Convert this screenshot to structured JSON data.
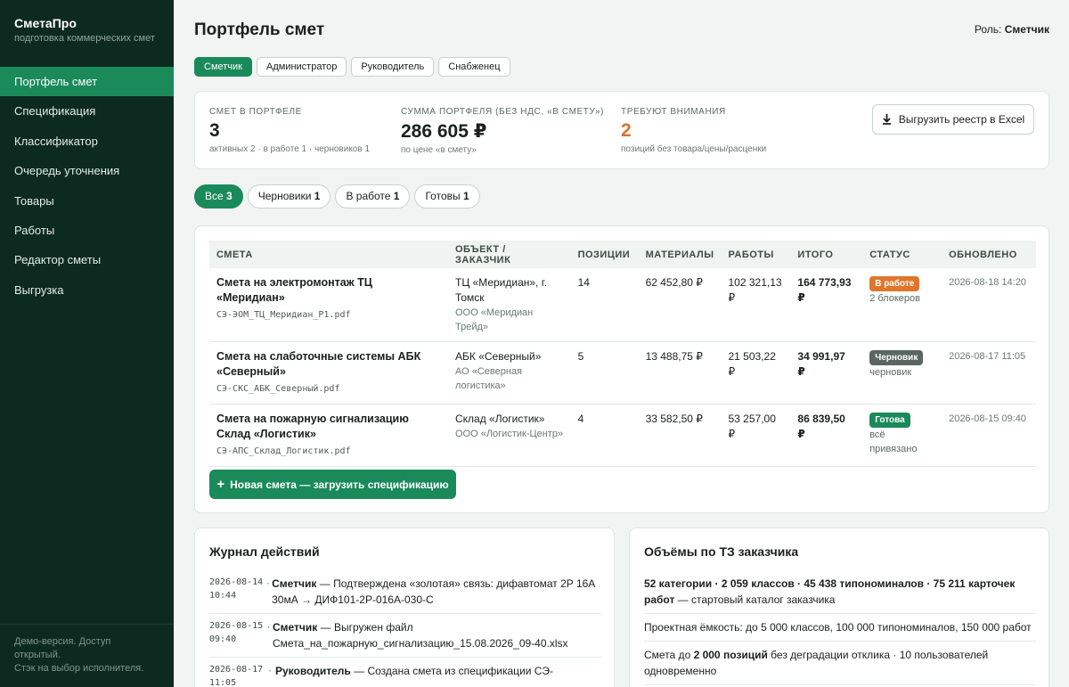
{
  "brand": {
    "name": "СметаПро",
    "subtitle": "подготовка коммерческих смет"
  },
  "nav": [
    "Портфель смет",
    "Спецификация",
    "Классификатор",
    "Очередь уточнения",
    "Товары",
    "Работы",
    "Редактор сметы",
    "Выгрузка"
  ],
  "nav_active": 0,
  "sidebar_footer": {
    "line1": "Демо-версия. Доступ открытый.",
    "line2": "Стэк на выбор исполнителя."
  },
  "page": {
    "title": "Портфель смет",
    "role_label": "Роль:",
    "role_value": "Сметчик"
  },
  "role_tabs": [
    "Сметчик",
    "Администратор",
    "Руководитель",
    "Снабженец"
  ],
  "stats": [
    {
      "label": "СМЕТ В ПОРТФЕЛЕ",
      "value": "3",
      "note": "активных 2 · в работе 1 · черновиков 1"
    },
    {
      "label": "СУММА ПОРТФЕЛЯ (БЕЗ НДС, «В СМЕТУ»)",
      "value": "286 605 ₽",
      "note": "по цене «в смету»"
    },
    {
      "label": "ТРЕБУЮТ ВНИМАНИЯ",
      "value": "2",
      "note": "позиций без товара/цены/расценки"
    }
  ],
  "export_button": "Выгрузить реестр в Excel",
  "filters": [
    {
      "label": "Все",
      "count": "3"
    },
    {
      "label": "Черновики",
      "count": "1"
    },
    {
      "label": "В работе",
      "count": "1"
    },
    {
      "label": "Готовы",
      "count": "1"
    }
  ],
  "table": {
    "headers": [
      "СМЕТА",
      "ОБЪЕКТ / ЗАКАЗЧИК",
      "ПОЗИЦИИ",
      "МАТЕРИАЛЫ",
      "РАБОТЫ",
      "ИТОГО",
      "СТАТУС",
      "ОБНОВЛЕНО"
    ],
    "rows": [
      {
        "name": "Смета на электромонтаж ТЦ «Меридиан»",
        "file": "СЭ-ЭОМ_ТЦ_Меридиан_Р1.pdf",
        "object": "ТЦ «Меридиан», г. Томск",
        "customer": "ООО «Меридиан Трейд»",
        "positions": "14",
        "materials": "62 452,80 ₽",
        "works": "102 321,13 ₽",
        "total": "164 773,93 ₽",
        "status": "В работе",
        "status_kind": "work",
        "status_note": "2 блокеров",
        "updated": "2026-08-18 14:20"
      },
      {
        "name": "Смета на слаботочные системы АБК «Северный»",
        "file": "СЭ-СКС_АБК_Северный.pdf",
        "object": "АБК «Северный»",
        "customer": "АО «Северная логистика»",
        "positions": "5",
        "materials": "13 488,75 ₽",
        "works": "21 503,22 ₽",
        "total": "34 991,97 ₽",
        "status": "Черновик",
        "status_kind": "draft",
        "status_note": "черновик",
        "updated": "2026-08-17 11:05"
      },
      {
        "name": "Смета на пожарную сигнализацию Склад «Логистик»",
        "file": "СЭ-АПС_Склад_Логистик.pdf",
        "object": "Склад «Логистик»",
        "customer": "ООО «Логистик-Центр»",
        "positions": "4",
        "materials": "33 582,50 ₽",
        "works": "53 257,00 ₽",
        "total": "86 839,50 ₽",
        "status": "Готова",
        "status_kind": "ready",
        "status_note": "всё привязано",
        "updated": "2026-08-15 09:40"
      }
    ]
  },
  "new_estimate_button": "Новая смета — загрузить спецификацию",
  "log": {
    "title": "Журнал действий",
    "entries": [
      {
        "ts": "2026-08-14 10:44",
        "actor": "Сметчик",
        "text": "— Подтверждена «золотая» связь: дифавтомат 2P 16A 30мА → ДИФ101-2Р-016А-030-С"
      },
      {
        "ts": "2026-08-15 09:40",
        "actor": "Сметчик",
        "text": "— Выгружен файл Смета_на_пожарную_сигнализацию_15.08.2026_09-40.xlsx"
      },
      {
        "ts": "2026-08-17 11:05",
        "actor": "Руководитель",
        "text": "— Создана смета из спецификации СЭ-"
      }
    ]
  },
  "volumes": {
    "title": "Объёмы по ТЗ заказчика",
    "rows": [
      {
        "bold": "52 категории · 2 059 классов · 45 438 типономиналов · 75 211 карточек работ",
        "text": " — стартовый каталог заказчика"
      },
      {
        "bold": "",
        "text": "Проектная ёмкость: до 5 000 классов, 100 000 типономиналов, 150 000 работ"
      },
      {
        "pre": "Смета до ",
        "bold": "2 000 позиций",
        "text": " без деградации отклика · 10 пользователей одновременно"
      }
    ]
  }
}
